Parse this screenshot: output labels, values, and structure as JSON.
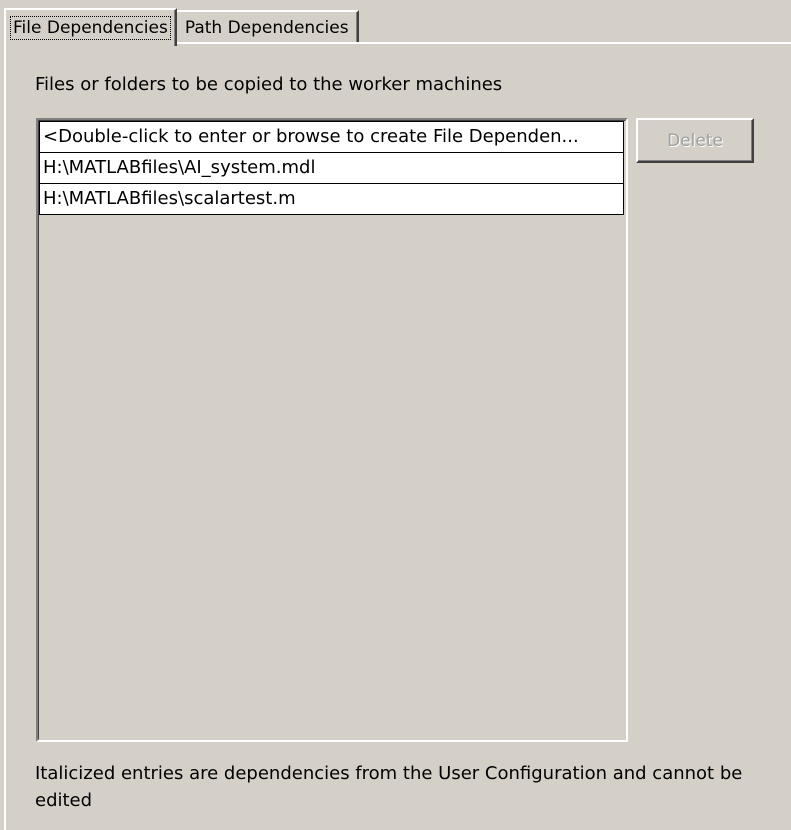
{
  "tabs": [
    {
      "label": "File Dependencies",
      "active": true
    },
    {
      "label": "Path Dependencies",
      "active": false
    }
  ],
  "heading": "Files or folders to be copied to the worker machines",
  "list": {
    "items": [
      "<Double-click to enter or browse to create File Dependen...",
      "H:\\MATLABfiles\\AI_system.mdl",
      "H:\\MATLABfiles\\scalartest.m"
    ]
  },
  "buttons": {
    "delete_label": "Delete",
    "delete_enabled": false
  },
  "footnote": "Italicized entries are dependencies from the User Configuration and cannot be edited"
}
